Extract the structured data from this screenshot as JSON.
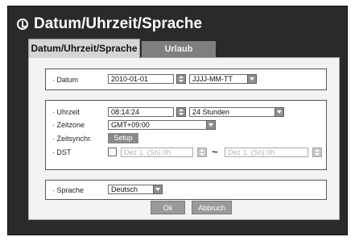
{
  "window": {
    "title": "Datum/Uhrzeit/Sprache"
  },
  "tabs": [
    {
      "label": "Datum/Uhrzeit/Sprache",
      "active": true
    },
    {
      "label": "Urlaub",
      "active": false
    }
  ],
  "date_group": {
    "date_label": "· Datum",
    "date_value": "2010-01-01",
    "format_value": "JJJJ-MM-TT"
  },
  "time_group": {
    "time_label": "· Uhrzeit",
    "time_value": "08:14:24",
    "hour_format_value": "24 Stunden",
    "timezone_label": "· Zeitzone",
    "timezone_value": "GMT+09:00",
    "sync_label": "· Zeitsynchr.",
    "setup_label": "Setup",
    "dst_label": "· DST",
    "dst_checked": false,
    "dst_start": "Dez 1. (So) 0h",
    "dst_separator": "~",
    "dst_end": "Dez 1. (So) 0h"
  },
  "language_group": {
    "language_label": "· Sprache",
    "language_value": "Deutsch"
  },
  "footer": {
    "ok_label": "Ok",
    "cancel_label": "Abbruch"
  }
}
